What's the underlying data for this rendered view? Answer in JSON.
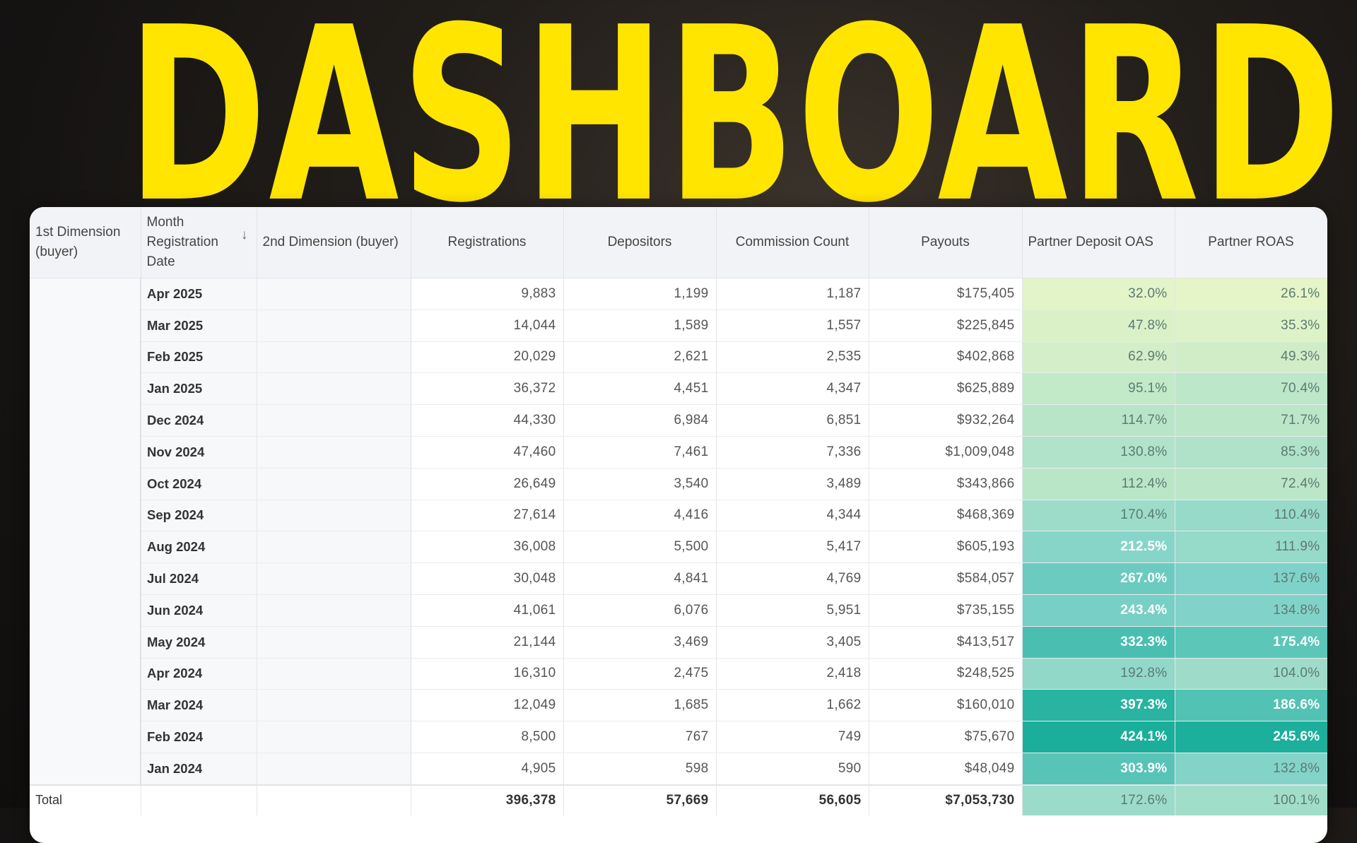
{
  "hero": {
    "title": "DASHBOARD",
    "color": "#ffe500"
  },
  "table": {
    "headers": {
      "dim1": "1st Dimension (buyer)",
      "month": "Month Registration Date",
      "sort_icon": "arrow-down-icon",
      "dim2": "2nd Dimension (buyer)",
      "registrations": "Registrations",
      "depositors": "Depositors",
      "commission_count": "Commission Count",
      "payouts": "Payouts",
      "deposit_oas": "Partner Deposit OAS",
      "roas": "Partner ROAS"
    },
    "rows": [
      {
        "month": "Apr 2025",
        "registrations": "9,883",
        "depositors": "1,199",
        "commission_count": "1,187",
        "payouts": "$175,405",
        "deposit_oas": "32.0%",
        "roas": "26.1%"
      },
      {
        "month": "Mar 2025",
        "registrations": "14,044",
        "depositors": "1,589",
        "commission_count": "1,557",
        "payouts": "$225,845",
        "deposit_oas": "47.8%",
        "roas": "35.3%"
      },
      {
        "month": "Feb 2025",
        "registrations": "20,029",
        "depositors": "2,621",
        "commission_count": "2,535",
        "payouts": "$402,868",
        "deposit_oas": "62.9%",
        "roas": "49.3%"
      },
      {
        "month": "Jan 2025",
        "registrations": "36,372",
        "depositors": "4,451",
        "commission_count": "4,347",
        "payouts": "$625,889",
        "deposit_oas": "95.1%",
        "roas": "70.4%"
      },
      {
        "month": "Dec 2024",
        "registrations": "44,330",
        "depositors": "6,984",
        "commission_count": "6,851",
        "payouts": "$932,264",
        "deposit_oas": "114.7%",
        "roas": "71.7%"
      },
      {
        "month": "Nov 2024",
        "registrations": "47,460",
        "depositors": "7,461",
        "commission_count": "7,336",
        "payouts": "$1,009,048",
        "deposit_oas": "130.8%",
        "roas": "85.3%"
      },
      {
        "month": "Oct 2024",
        "registrations": "26,649",
        "depositors": "3,540",
        "commission_count": "3,489",
        "payouts": "$343,866",
        "deposit_oas": "112.4%",
        "roas": "72.4%"
      },
      {
        "month": "Sep 2024",
        "registrations": "27,614",
        "depositors": "4,416",
        "commission_count": "4,344",
        "payouts": "$468,369",
        "deposit_oas": "170.4%",
        "roas": "110.4%"
      },
      {
        "month": "Aug 2024",
        "registrations": "36,008",
        "depositors": "5,500",
        "commission_count": "5,417",
        "payouts": "$605,193",
        "deposit_oas": "212.5%",
        "roas": "111.9%"
      },
      {
        "month": "Jul 2024",
        "registrations": "30,048",
        "depositors": "4,841",
        "commission_count": "4,769",
        "payouts": "$584,057",
        "deposit_oas": "267.0%",
        "roas": "137.6%"
      },
      {
        "month": "Jun 2024",
        "registrations": "41,061",
        "depositors": "6,076",
        "commission_count": "5,951",
        "payouts": "$735,155",
        "deposit_oas": "243.4%",
        "roas": "134.8%"
      },
      {
        "month": "May 2024",
        "registrations": "21,144",
        "depositors": "3,469",
        "commission_count": "3,405",
        "payouts": "$413,517",
        "deposit_oas": "332.3%",
        "roas": "175.4%"
      },
      {
        "month": "Apr 2024",
        "registrations": "16,310",
        "depositors": "2,475",
        "commission_count": "2,418",
        "payouts": "$248,525",
        "deposit_oas": "192.8%",
        "roas": "104.0%"
      },
      {
        "month": "Mar 2024",
        "registrations": "12,049",
        "depositors": "1,685",
        "commission_count": "1,662",
        "payouts": "$160,010",
        "deposit_oas": "397.3%",
        "roas": "186.6%"
      },
      {
        "month": "Feb 2024",
        "registrations": "8,500",
        "depositors": "767",
        "commission_count": "749",
        "payouts": "$75,670",
        "deposit_oas": "424.1%",
        "roas": "245.6%"
      },
      {
        "month": "Jan 2024",
        "registrations": "4,905",
        "depositors": "598",
        "commission_count": "590",
        "payouts": "$48,049",
        "deposit_oas": "303.9%",
        "roas": "132.8%"
      }
    ],
    "total": {
      "label": "Total",
      "registrations": "396,378",
      "depositors": "57,669",
      "commission_count": "56,605",
      "payouts": "$7,053,730",
      "deposit_oas": "172.6%",
      "roas": "100.1%"
    },
    "heat_colors": {
      "low": "#e6f5c8",
      "mid": "#7fd2c9",
      "high": "#18ae9a"
    }
  }
}
